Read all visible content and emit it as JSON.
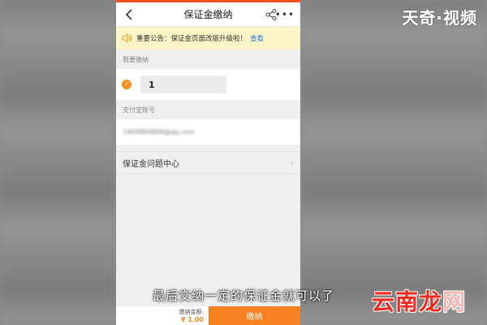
{
  "watermark": "天奇·视频",
  "nav": {
    "title": "保证金缴纳",
    "more": "•••"
  },
  "notice": {
    "text": "重要公告：保证金页面改版升级啦！",
    "link": "查看"
  },
  "pay": {
    "label": "我要缴纳",
    "amount": "1"
  },
  "account": {
    "label": "支付宝账号",
    "value": "1409864809@qq.com"
  },
  "help": {
    "label": "保证金问题中心",
    "chevron": "›"
  },
  "bottom": {
    "total_label": "缴纳金额:",
    "total_value": "¥ 1.00",
    "pay_button": "缴纳"
  },
  "subtitle": "最后交纳一定的保证金就可以了",
  "logo": {
    "main": "云南龙",
    "last": "网"
  },
  "colors": {
    "accent": "#f5821f",
    "link": "#2e7bd6",
    "notice_bg": "#fdf4c8",
    "status": "#f4511e"
  }
}
